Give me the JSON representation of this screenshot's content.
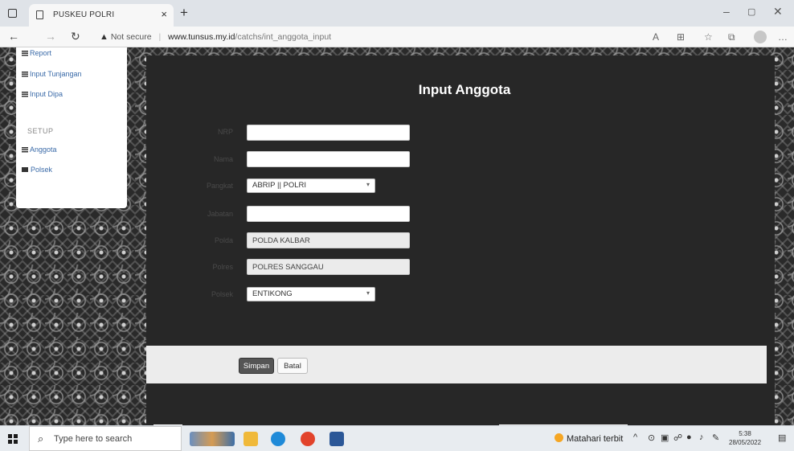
{
  "browser": {
    "tab_title": "PUSKEU POLRI",
    "tab_close": "×",
    "new_tab": "+",
    "security_label": "Not secure",
    "url_host": "www.tunsus.my.id",
    "url_path": "/catchs/int_anggota_input"
  },
  "sidebar": {
    "items_top": [
      {
        "label": "Report"
      },
      {
        "label": "Input Tunjangan"
      },
      {
        "label": "Input Dipa"
      }
    ],
    "section_heading": "SETUP",
    "items_setup": [
      {
        "label": "Anggota"
      },
      {
        "label": "Polsek"
      }
    ]
  },
  "form": {
    "title": "Input Anggota",
    "fields": {
      "nrp": {
        "label": "NRP",
        "value": ""
      },
      "nama": {
        "label": "Nama",
        "value": ""
      },
      "pangkat": {
        "label": "Pangkat",
        "value": "ABRIP || POLRI"
      },
      "jabatan": {
        "label": "Jabatan",
        "value": ""
      },
      "polda": {
        "label": "Polda",
        "value": "POLDA KALBAR"
      },
      "polres": {
        "label": "Polres",
        "value": "POLRES SANGGAU"
      },
      "polsek": {
        "label": "Polsek",
        "value": "ENTIKONG"
      }
    },
    "buttons": {
      "save": "Simpan",
      "cancel": "Batal"
    }
  },
  "taskbar": {
    "search_placeholder": "Type here to search",
    "weather": "Matahari terbit",
    "time": "5:38",
    "date": "28/05/2022"
  },
  "colors": {
    "link": "#3a6aa8",
    "panel": "#272727",
    "button_bar": "#ececec"
  }
}
